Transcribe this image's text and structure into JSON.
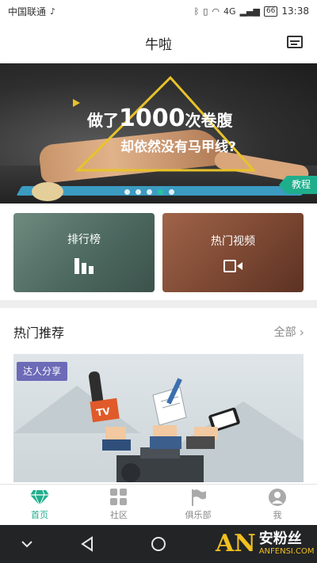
{
  "status_bar": {
    "carrier": "中国联通",
    "battery": "66",
    "network": "4G",
    "time": "13:38"
  },
  "header": {
    "title": "牛啦"
  },
  "banner": {
    "line1_prefix": "做了",
    "line1_number": "1000",
    "line1_suffix": "次卷腹",
    "line2": "却依然没有马甲线?",
    "tag": "教程",
    "dots_count": 5,
    "active_dot": 3
  },
  "tiles": [
    {
      "label": "排行榜",
      "icon": "bar-chart-icon"
    },
    {
      "label": "热门视频",
      "icon": "video-camera-icon"
    }
  ],
  "section": {
    "title": "热门推荐",
    "more": "全部"
  },
  "recommend_card": {
    "tag": "达人分享",
    "tv_label": "TV"
  },
  "bottom_nav": [
    {
      "label": "首页",
      "icon": "diamond-icon",
      "active": true
    },
    {
      "label": "社区",
      "icon": "grid-icon",
      "active": false
    },
    {
      "label": "俱乐部",
      "icon": "flag-icon",
      "active": false
    },
    {
      "label": "我",
      "icon": "user-icon",
      "active": false
    }
  ],
  "watermark": {
    "logo": "AN",
    "cn": "安粉丝",
    "en": "ANFENSI.COM"
  },
  "colors": {
    "accent": "#1fae8c",
    "tag_purple": "#6d6ab8",
    "triangle": "#e8c32a"
  }
}
